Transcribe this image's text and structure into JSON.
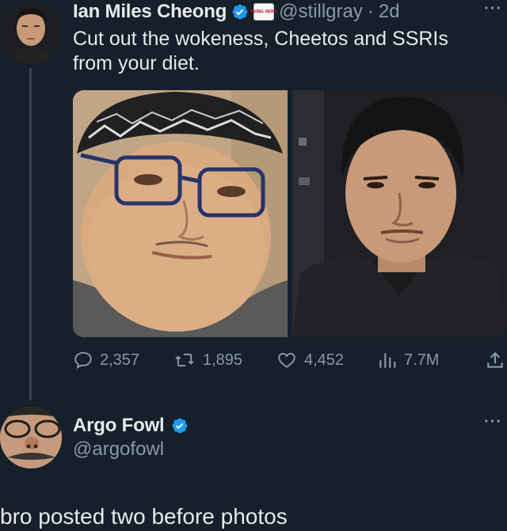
{
  "tweet1": {
    "author_name": "Ian Miles Cheong",
    "handle": "@stillgray",
    "separator": "·",
    "time": "2d",
    "affiliation_badge_text": "REBEL NEWS",
    "text_line1": "Cut out the wokeness, Cheetos and SSRIs",
    "text_line2": "from your diet.",
    "more_label": "···",
    "actions": {
      "replies": "2,357",
      "reposts": "1,895",
      "likes": "4,452",
      "views": "7.7M"
    },
    "photos": [
      {
        "icon": "photo-before"
      },
      {
        "icon": "photo-after"
      }
    ]
  },
  "tweet2": {
    "author_name": "Argo Fowl",
    "handle": "@argofowl",
    "more_label": "···"
  },
  "caption": "bro posted two before photos",
  "colors": {
    "background": "#15202b",
    "text": "#e7e9ea",
    "muted": "#8b98a5",
    "verified": "#1d9bf0",
    "thread_line": "#38444d"
  }
}
